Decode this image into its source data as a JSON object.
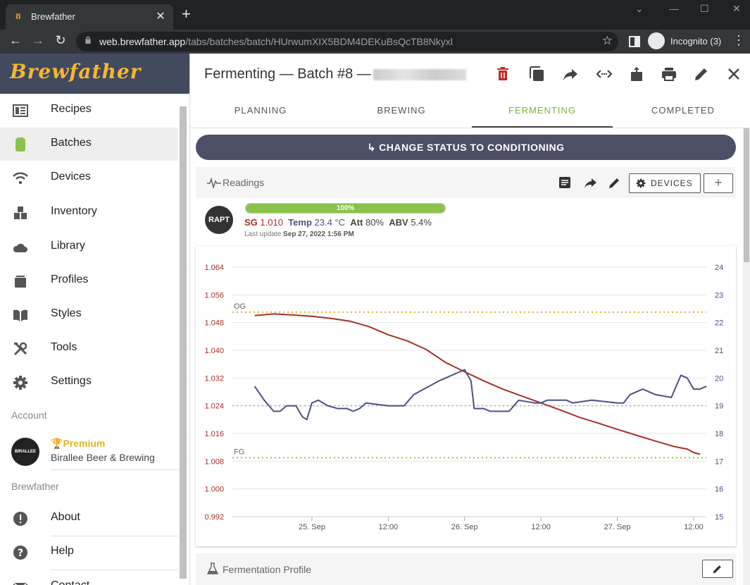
{
  "browser": {
    "tab_title": "Brewfather",
    "tab_favicon": "8",
    "url_host": "web.brewfather.app",
    "url_path": "/tabs/batches/batch/HUrwumXIX5BDM4DEKuBsQcTB8Nkyxl",
    "incognito_label": "Incognito (3)"
  },
  "sidebar": {
    "brand": "Brewfather",
    "items": [
      {
        "label": "Recipes",
        "icon": "recipes-icon"
      },
      {
        "label": "Batches",
        "icon": "batches-icon"
      },
      {
        "label": "Devices",
        "icon": "wifi-icon"
      },
      {
        "label": "Inventory",
        "icon": "inventory-icon"
      },
      {
        "label": "Library",
        "icon": "cloud-icon"
      },
      {
        "label": "Profiles",
        "icon": "profiles-icon"
      },
      {
        "label": "Styles",
        "icon": "book-icon"
      },
      {
        "label": "Tools",
        "icon": "tools-icon"
      },
      {
        "label": "Settings",
        "icon": "gear-icon"
      }
    ],
    "account_header": "Account",
    "account_tier": "Premium",
    "account_name": "Biral​lee Beer & Brewing",
    "account_avatar_text": "BIRALLEE",
    "brewfather_header": "Brewfather",
    "footer_items": [
      {
        "label": "About",
        "icon": "info-icon"
      },
      {
        "label": "Help",
        "icon": "help-icon"
      },
      {
        "label": "Contact",
        "icon": "mail-icon"
      }
    ]
  },
  "header": {
    "title": "Fermenting — Batch #8 —"
  },
  "tabs": [
    {
      "label": "PLANNING"
    },
    {
      "label": "BREWING"
    },
    {
      "label": "FERMENTING"
    },
    {
      "label": "COMPLETED"
    }
  ],
  "status_button": "CHANGE STATUS TO CONDITIONING",
  "readings": {
    "title": "Readings",
    "devices_label": "DEVICES",
    "add_label": "+"
  },
  "device": {
    "logo_text": "RAPT",
    "progress": 100,
    "progress_label": "100%",
    "sg_label": "SG",
    "sg_value": "1.010",
    "temp_label": "Temp",
    "temp_value": "23.4 °C",
    "att_label": "Att",
    "att_value": "80%",
    "abv_label": "ABV",
    "abv_value": "5.4%",
    "last_update_label": "Last update",
    "last_update_value": "Sep 27, 2022 1:56 PM"
  },
  "fermentation_profile": {
    "title": "Fermentation Profile"
  },
  "colors": {
    "sg": "#a5312c",
    "temp": "#4a5186",
    "og_line": "#e0b52a",
    "fg_line": "#9bc34a",
    "accent": "#7cb342",
    "brand_bg": "#414a5e",
    "brand_text": "#f4b731"
  },
  "chart_data": {
    "type": "line",
    "x_ticks": [
      "25. Sep",
      "12:00",
      "26. Sep",
      "12:00",
      "27. Sep",
      "12:00"
    ],
    "x_tick_hours": [
      0,
      12,
      24,
      36,
      48,
      60
    ],
    "x_range_hours": [
      -12.5,
      62
    ],
    "y_left_ticks": [
      "1.064",
      "1.056",
      "1.048",
      "1.040",
      "1.032",
      "1.024",
      "1.016",
      "1.008",
      "1.000",
      "0.992"
    ],
    "y_left_range": [
      0.992,
      1.064
    ],
    "y_right_ticks": [
      "24",
      "23",
      "22",
      "21",
      "20",
      "19",
      "18",
      "17",
      "16",
      "15"
    ],
    "y_right_range": [
      15,
      24
    ],
    "reference_lines": [
      {
        "label": "OG",
        "value": 1.051,
        "axis": "left"
      },
      {
        "label": "FG",
        "value": 1.009,
        "axis": "left"
      },
      {
        "label": "",
        "value": 19,
        "axis": "right"
      }
    ],
    "series": [
      {
        "name": "SG",
        "axis": "left",
        "points": [
          [
            -9,
            1.05
          ],
          [
            -6,
            1.0505
          ],
          [
            -3,
            1.0502
          ],
          [
            0,
            1.0498
          ],
          [
            3,
            1.0492
          ],
          [
            6,
            1.0484
          ],
          [
            9,
            1.0468
          ],
          [
            12,
            1.0445
          ],
          [
            15,
            1.0427
          ],
          [
            18,
            1.0402
          ],
          [
            21,
            1.0365
          ],
          [
            24,
            1.0338
          ],
          [
            27,
            1.0312
          ],
          [
            30,
            1.0288
          ],
          [
            33,
            1.0268
          ],
          [
            36,
            1.0248
          ],
          [
            39,
            1.0228
          ],
          [
            42,
            1.0207
          ],
          [
            45,
            1.019
          ],
          [
            48,
            1.0172
          ],
          [
            51,
            1.0155
          ],
          [
            54,
            1.0138
          ],
          [
            57,
            1.0122
          ],
          [
            59,
            1.0115
          ],
          [
            60,
            1.0105
          ],
          [
            61,
            1.01
          ]
        ]
      },
      {
        "name": "Temp",
        "axis": "right",
        "points": [
          [
            -9,
            19.7
          ],
          [
            -7.5,
            19.2
          ],
          [
            -6,
            18.8
          ],
          [
            -5,
            18.8
          ],
          [
            -4,
            19.0
          ],
          [
            -2.5,
            19.0
          ],
          [
            -1.5,
            18.6
          ],
          [
            -0.8,
            18.5
          ],
          [
            0,
            19.1
          ],
          [
            1,
            19.2
          ],
          [
            2.5,
            19.0
          ],
          [
            4,
            18.9
          ],
          [
            5.5,
            18.9
          ],
          [
            6.5,
            18.8
          ],
          [
            7.5,
            18.9
          ],
          [
            8.5,
            19.1
          ],
          [
            12,
            19.0
          ],
          [
            14.5,
            19.0
          ],
          [
            16,
            19.4
          ],
          [
            20,
            19.9
          ],
          [
            24,
            20.3
          ],
          [
            25,
            19.9
          ],
          [
            25.5,
            18.9
          ],
          [
            27,
            18.9
          ],
          [
            28,
            18.8
          ],
          [
            30,
            18.8
          ],
          [
            31,
            18.8
          ],
          [
            32.5,
            19.2
          ],
          [
            35,
            19.1
          ],
          [
            36,
            19.1
          ],
          [
            37,
            19.2
          ],
          [
            40,
            19.2
          ],
          [
            41,
            19.1
          ],
          [
            44,
            19.2
          ],
          [
            48,
            19.1
          ],
          [
            49,
            19.1
          ],
          [
            50,
            19.4
          ],
          [
            52,
            19.6
          ],
          [
            54,
            19.4
          ],
          [
            56.5,
            19.3
          ],
          [
            58,
            20.1
          ],
          [
            59,
            20.0
          ],
          [
            60,
            19.6
          ],
          [
            61,
            19.6
          ],
          [
            62,
            19.7
          ]
        ]
      }
    ]
  }
}
